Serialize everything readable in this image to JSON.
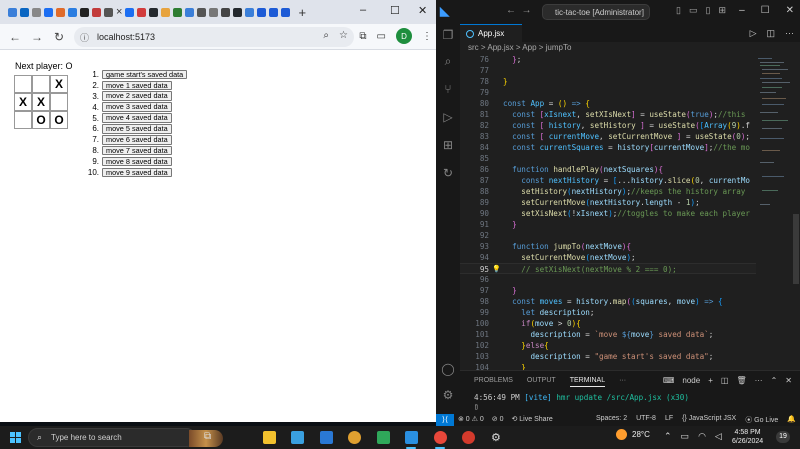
{
  "browser": {
    "new_tab_label": "+",
    "tab_close": "×",
    "url": "localhost:5173",
    "profile_initial": "D",
    "window_controls": [
      "–",
      "☐",
      "✕"
    ]
  },
  "game": {
    "status": "Next player: O",
    "squares": [
      "",
      "",
      "X",
      "X",
      "X",
      "",
      "",
      "O",
      "O"
    ],
    "moves": [
      {
        "num": "1.",
        "label": "game start's saved data"
      },
      {
        "num": "2.",
        "label": "move 1 saved data"
      },
      {
        "num": "3.",
        "label": "move 2 saved data"
      },
      {
        "num": "4.",
        "label": "move 3 saved data"
      },
      {
        "num": "5.",
        "label": "move 4 saved data"
      },
      {
        "num": "6.",
        "label": "move 5 saved data"
      },
      {
        "num": "7.",
        "label": "move 6 saved data"
      },
      {
        "num": "8.",
        "label": "move 7 saved data"
      },
      {
        "num": "9.",
        "label": "move 8 saved data"
      },
      {
        "num": "10.",
        "label": "move 9 saved data"
      }
    ]
  },
  "vscode": {
    "search_placeholder": "tic-tac-toe [Administrator]",
    "tab_label": "App.jsx",
    "breadcrumb": [
      "src",
      "App.jsx",
      "App",
      "jumpTo"
    ],
    "current_line": "95",
    "code_lines": [
      {
        "n": "76",
        "html": "  <span class='p2'>}</span>;"
      },
      {
        "n": "77",
        "html": ""
      },
      {
        "n": "78",
        "html": "<span class='p1'>}</span>"
      },
      {
        "n": "79",
        "html": ""
      },
      {
        "n": "80",
        "html": "<span class='k'>const</span> <span class='cn'>App</span> = <span class='p1'>()</span> <span class='k'>=&gt;</span> <span class='p1'>{</span>"
      },
      {
        "n": "81",
        "html": "  <span class='k'>const</span> <span class='p2'>[</span><span class='cn'>xIsnext</span>, <span class='f'>setXIsNext</span><span class='p2'>]</span> = <span class='f'>useState</span><span class='p2'>(</span><span class='k'>true</span><span class='p2'>)</span>;<span class='c'>//this</span>"
      },
      {
        "n": "82",
        "html": "  <span class='k'>const</span> <span class='p2'>[</span> <span class='cn'>history</span>, <span class='f'>setHistory</span> <span class='p2'>]</span> = <span class='f'>useState</span><span class='p2'>(</span><span class='p3'>[</span><span class='cn'>Array</span><span class='p1'>(</span><span class='n'>9</span><span class='p1'>)</span>.f"
      },
      {
        "n": "83",
        "html": "  <span class='k'>const</span> <span class='p2'>[</span> <span class='cn'>currentMove</span>, <span class='f'>setCurrentMove</span> <span class='p2'>]</span> = <span class='f'>useState</span><span class='p2'>(</span><span class='n'>0</span><span class='p2'>)</span>;"
      },
      {
        "n": "84",
        "html": "  <span class='k'>const</span> <span class='cn'>currentSquares</span> = <span class='v'>history</span><span class='p2'>[</span><span class='v'>currentMove</span><span class='p2'>]</span>;<span class='c'>//the mo</span>"
      },
      {
        "n": "85",
        "html": ""
      },
      {
        "n": "86",
        "html": "  <span class='k'>function</span> <span class='f'>handlePlay</span><span class='p2'>(</span><span class='v'>nextSquares</span><span class='p2'>){</span>"
      },
      {
        "n": "87",
        "html": "    <span class='k'>const</span> <span class='cn'>nextHistory</span> = <span class='p3'>[</span>...<span class='v'>history</span>.<span class='f'>slice</span><span class='p1'>(</span><span class='n'>0</span>, <span class='v'>currentMo</span>"
      },
      {
        "n": "88",
        "html": "    <span class='f'>setHistory</span><span class='p3'>(</span><span class='v'>nextHistory</span><span class='p3'>)</span>;<span class='c'>//keeps the history array</span>"
      },
      {
        "n": "89",
        "html": "    <span class='f'>setCurrentMove</span><span class='p3'>(</span><span class='v'>nextHistory</span>.<span class='v'>length</span> - <span class='n'>1</span><span class='p3'>)</span>;"
      },
      {
        "n": "90",
        "html": "    <span class='f'>setXisNext</span><span class='p3'>(</span>!<span class='v'>xIsnext</span><span class='p3'>)</span>;<span class='c'>//toggles to make each player</span>"
      },
      {
        "n": "91",
        "html": "  <span class='p2'>}</span>"
      },
      {
        "n": "92",
        "html": ""
      },
      {
        "n": "93",
        "html": "  <span class='k'>function</span> <span class='f'>jumpTo</span><span class='p2'>(</span><span class='v'>nextMove</span><span class='p2'>){</span>"
      },
      {
        "n": "94",
        "html": "    <span class='f'>setCurrentMove</span><span class='p3'>(</span><span class='v'>nextMove</span><span class='p3'>)</span>;"
      },
      {
        "n": "95",
        "html": "    <span class='c'>// setXisNext(nextMove % 2 === 0);</span>"
      },
      {
        "n": "96",
        "html": ""
      },
      {
        "n": "97",
        "html": "  <span class='p2'>}</span>"
      },
      {
        "n": "98",
        "html": "  <span class='k'>const</span> <span class='cn'>moves</span> = <span class='v'>history</span>.<span class='f'>map</span><span class='p2'>(</span><span class='p3'>(</span><span class='v'>squares</span>, <span class='v'>move</span><span class='p3'>)</span> <span class='k'>=&gt;</span> <span class='p3'>{</span>"
      },
      {
        "n": "99",
        "html": "    <span class='k'>let</span> <span class='v'>description</span>;"
      },
      {
        "n": "100",
        "html": "    <span class='kc'>if</span><span class='p1'>(</span><span class='v'>move</span> &gt; <span class='n'>0</span><span class='p1'>){</span>"
      },
      {
        "n": "101",
        "html": "      <span class='v'>description</span> = <span class='s'>`move </span><span class='k'>${</span><span class='v'>move</span><span class='k'>}</span><span class='s'> saved data`</span>;"
      },
      {
        "n": "102",
        "html": "    <span class='p1'>}</span><span class='kc'>else</span><span class='p1'>{</span>"
      },
      {
        "n": "103",
        "html": "      <span class='v'>description</span> = <span class='s'>\"game start's saved data\"</span>;"
      },
      {
        "n": "104",
        "html": "    <span class='p1'>}</span>"
      }
    ],
    "panel_tabs": [
      "PROBLEMS",
      "OUTPUT",
      "TERMINAL",
      "···"
    ],
    "terminal_shell": "node",
    "terminal_time": "4:56:49 PM",
    "terminal_vite": "[vite]",
    "terminal_msg": "hmr update /src/App.jsx (x30)",
    "status_left": [
      "⊗ 0 ⚠ 0",
      "⊘ 0",
      "⟲ Live Share"
    ],
    "status_right": [
      "Spaces: 2",
      "UTF-8",
      "LF",
      "{} JavaScript JSX",
      "⦿ Go Live",
      "🔔"
    ]
  },
  "taskbar": {
    "search_placeholder": "Type here to search",
    "temperature": "28°C",
    "time": "4:58 PM",
    "date": "6/26/2024",
    "notifications": "19"
  },
  "colors": {
    "accent": "#0078d4",
    "taskbar_accent": "#4cc2ff",
    "vscode_bg": "#1f1f1f",
    "browser_bg": "#ffffff"
  }
}
